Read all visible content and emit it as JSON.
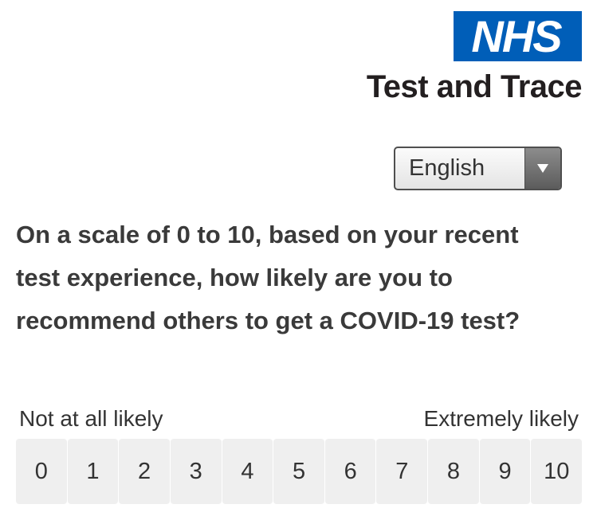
{
  "header": {
    "logo_text": "NHS",
    "logo_color": "#005eb8",
    "service_name": "Test and Trace"
  },
  "language_select": {
    "selected": "English",
    "arrow_icon": "triangle-down-icon"
  },
  "question": {
    "text": "On a scale of 0 to 10, based on your recent test experience, how likely are you to recommend others to get a COVID-19 test?"
  },
  "scale": {
    "min_label": "Not at all likely",
    "max_label": "Extremely likely",
    "options": [
      "0",
      "1",
      "2",
      "3",
      "4",
      "5",
      "6",
      "7",
      "8",
      "9",
      "10"
    ]
  }
}
